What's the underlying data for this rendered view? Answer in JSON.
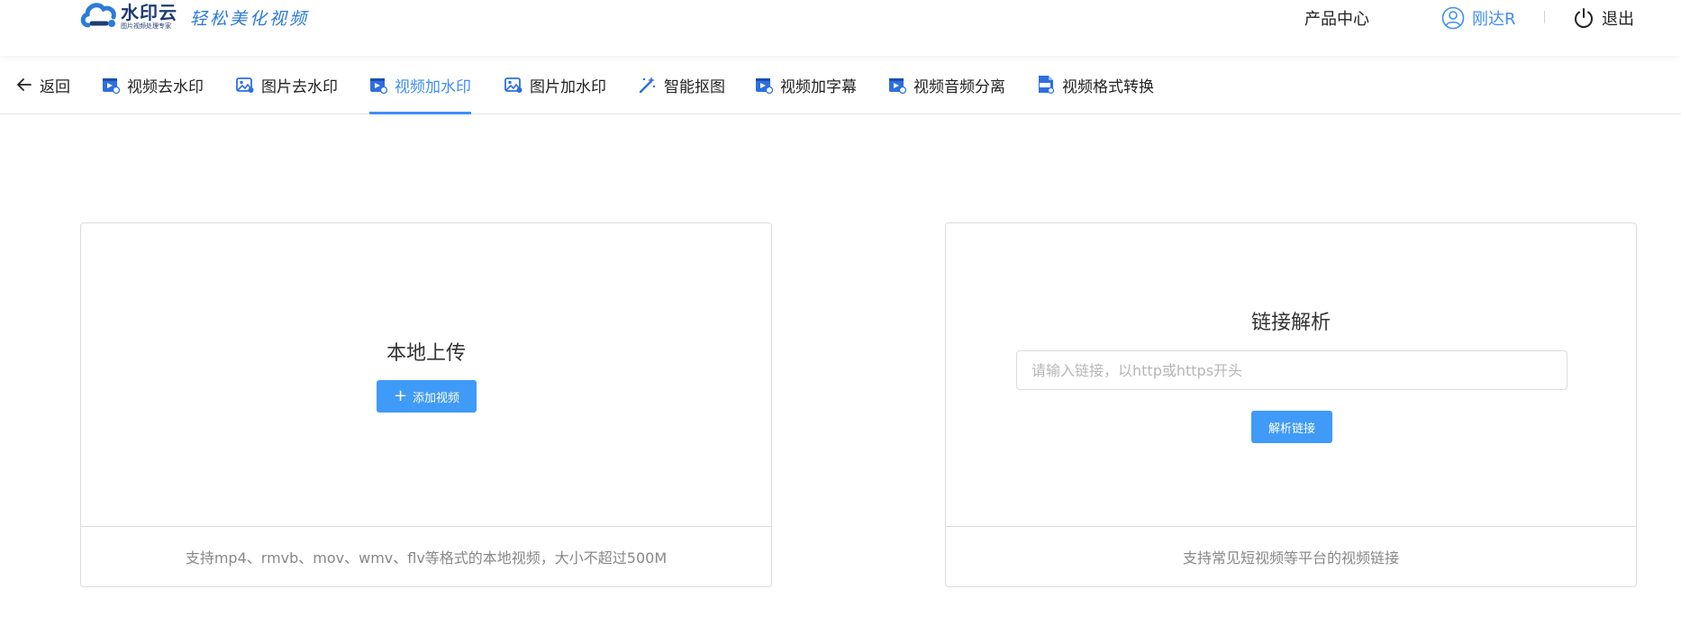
{
  "header": {
    "logo_name": "水印云",
    "logo_tagline": "图片视频处理专家",
    "logo_slogan": "轻松美化视频",
    "product_center": "产品中心",
    "user_name": "刚达R",
    "logout": "退出"
  },
  "tabs": [
    {
      "label": "返回",
      "icon": "arrow-left-icon"
    },
    {
      "label": "视频去水印",
      "icon": "video-icon"
    },
    {
      "label": "图片去水印",
      "icon": "image-icon"
    },
    {
      "label": "视频加水印",
      "icon": "video-icon",
      "active": true
    },
    {
      "label": "图片加水印",
      "icon": "image-icon"
    },
    {
      "label": "智能抠图",
      "icon": "magic-wand-icon"
    },
    {
      "label": "视频加字幕",
      "icon": "video-icon"
    },
    {
      "label": "视频音频分离",
      "icon": "video-icon"
    },
    {
      "label": "视频格式转换",
      "icon": "mp4-file-icon"
    }
  ],
  "upload_card": {
    "title": "本地上传",
    "button_label": "添加视频",
    "footer": "支持mp4、rmvb、mov、wmv、flv等格式的本地视频，大小不超过500M"
  },
  "link_card": {
    "title": "链接解析",
    "input_value": "",
    "input_placeholder": "请输入链接，以http或https开头",
    "button_label": "解析链接",
    "footer": "支持常见短视频等平台的视频链接"
  },
  "colors": {
    "accent": "#3f8ef7",
    "button": "#3f9bf7",
    "logo_dark": "#1f3b73"
  }
}
